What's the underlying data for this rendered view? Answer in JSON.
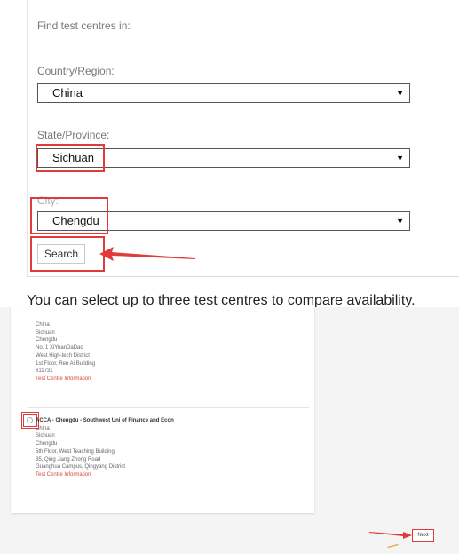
{
  "search_panel": {
    "heading": "Find test centres in:",
    "country_label": "Country/Region:",
    "country_value": "China",
    "state_label": "State/Province:",
    "state_value": "Sichuan",
    "city_label": "City:",
    "city_value": "Chengdu",
    "search_button": "Search"
  },
  "caption": "You can select up to three test centres to compare availability.",
  "results": [
    {
      "name": "",
      "lines": [
        "China",
        "Sichuan",
        "Chengdu",
        "No. 1 XiYuanDaDao",
        "West High-tech District",
        "1st Floor, Ren Ai Building",
        "611731"
      ],
      "link": "Test Centre Information"
    },
    {
      "name": "ACCA - Chengdu - Southwest Uni of Finance and Econ",
      "lines": [
        "China",
        "Sichuan",
        "Chengdu",
        "5th Floor, West Teaching Building",
        "35, Qing Jiang Zhong Road",
        "Guanghua Campus, Qingyang District"
      ],
      "link": "Test Centre Information"
    }
  ],
  "next_button": "Next",
  "colors": {
    "highlight": "#e03a3a",
    "link": "#d84b3a"
  }
}
